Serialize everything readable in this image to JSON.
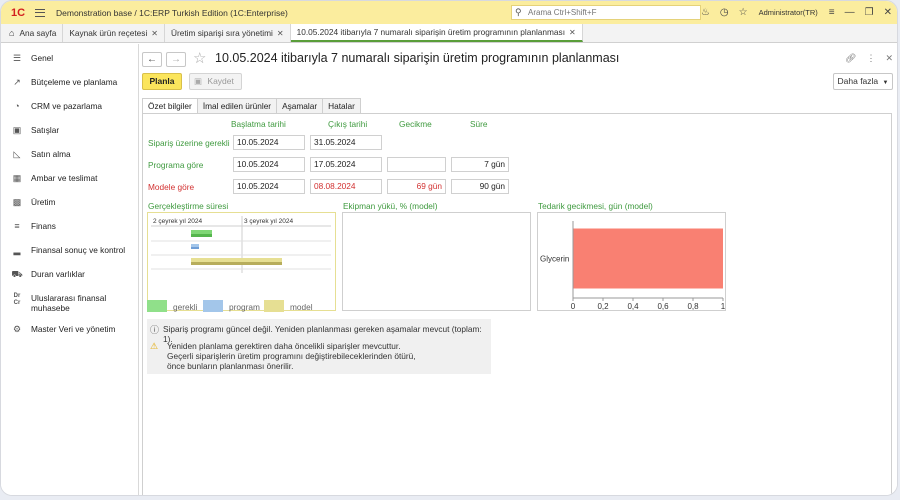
{
  "titlebar": {
    "app_title": "Demonstration base / 1C:ERP Turkish Edition  (1C:Enterprise)",
    "search_placeholder": "Arama Ctrl+Shift+F",
    "user": "Administrator(TR)"
  },
  "tabs": [
    {
      "label": "Ana sayfa"
    },
    {
      "label": "Kaynak ürün reçetesi"
    },
    {
      "label": "Üretim siparişi sıra yönetimi"
    },
    {
      "label": "10.05.2024 itibarıyla 7 numaralı siparişin üretim programının planlanması"
    }
  ],
  "sidebar": {
    "items": [
      {
        "label": "Genel",
        "icon": "menu-lines-icon"
      },
      {
        "label": "Bütçeleme ve planlama",
        "icon": "chart-icon"
      },
      {
        "label": "CRM ve pazarlama",
        "icon": "pie-icon"
      },
      {
        "label": "Satışlar",
        "icon": "bag-icon"
      },
      {
        "label": "Satın alma",
        "icon": "cart-icon"
      },
      {
        "label": "Ambar ve teslimat",
        "icon": "grid-icon"
      },
      {
        "label": "Üretim",
        "icon": "factory-icon"
      },
      {
        "label": "Finans",
        "icon": "coins-icon"
      },
      {
        "label": "Finansal sonuç ve kontrol",
        "icon": "bar-icon"
      },
      {
        "label": "Duran varlıklar",
        "icon": "truck-icon"
      },
      {
        "label": "Uluslararası finansal muhasebe",
        "icon": "drcr-icon"
      },
      {
        "label": "Master Veri ve yönetim",
        "icon": "gear-icon"
      }
    ]
  },
  "page": {
    "title": "10.05.2024 itibarıyla 7 numaralı siparişin üretim programının planlanması",
    "plan_label": "Planla",
    "save_label": "Kaydet",
    "more_label": "Daha fazla",
    "form_tabs": [
      "Özet bilgiler",
      "İmal edilen ürünler",
      "Aşamalar",
      "Hatalar"
    ]
  },
  "summary": {
    "columns": [
      "Başlatma tarihi",
      "Çıkış tarihi",
      "Gecikme",
      "Süre"
    ],
    "rows": [
      {
        "label": "Sipariş üzerine gerekli",
        "start": "10.05.2024",
        "end": "31.05.2024",
        "delay": "",
        "duration": "",
        "status": "normal"
      },
      {
        "label": "Programa göre",
        "start": "10.05.2024",
        "end": "17.05.2024",
        "delay": "",
        "duration": "7 gün",
        "status": "normal"
      },
      {
        "label": "Modele göre",
        "start": "10.05.2024",
        "end": "08.08.2024",
        "delay": "69 gün",
        "duration": "90 gün",
        "status": "late"
      }
    ]
  },
  "gantt": {
    "title": "Gerçekleştirme süresi",
    "quarters": [
      "2 çeyrek yıl 2024",
      "3 çeyrek yıl 2024"
    ],
    "legend": [
      {
        "name": "gerekli",
        "color": "#90e08a"
      },
      {
        "name": "program",
        "color": "#a3c6ea"
      },
      {
        "name": "model",
        "color": "#e6df93"
      }
    ]
  },
  "equipment": {
    "title": "Ekipman yükü, % (model)"
  },
  "chart_data": {
    "type": "bar",
    "orientation": "horizontal",
    "title": "Tedarik gecikmesi, gün (model)",
    "categories": [
      "Glycerin"
    ],
    "values": [
      1
    ],
    "xlim": [
      0,
      1
    ],
    "xticks": [
      "0",
      "0,2",
      "0,4",
      "0,6",
      "0,8",
      "1"
    ],
    "bar_color": "#f98072"
  },
  "messages": [
    {
      "icon": "info-icon",
      "text": "Sipariş programı güncel değil. Yeniden planlanması gereken aşamalar mevcut (toplam: 1)."
    },
    {
      "icon": "warning-icon",
      "lines": [
        "Yeniden planlama gerektiren daha öncelikli siparişler mevcuttur.",
        "Geçerli siparişlerin üretim programını değiştirebileceklerinden ötürü,",
        "önce bunların planlanması önerilir."
      ]
    }
  ]
}
